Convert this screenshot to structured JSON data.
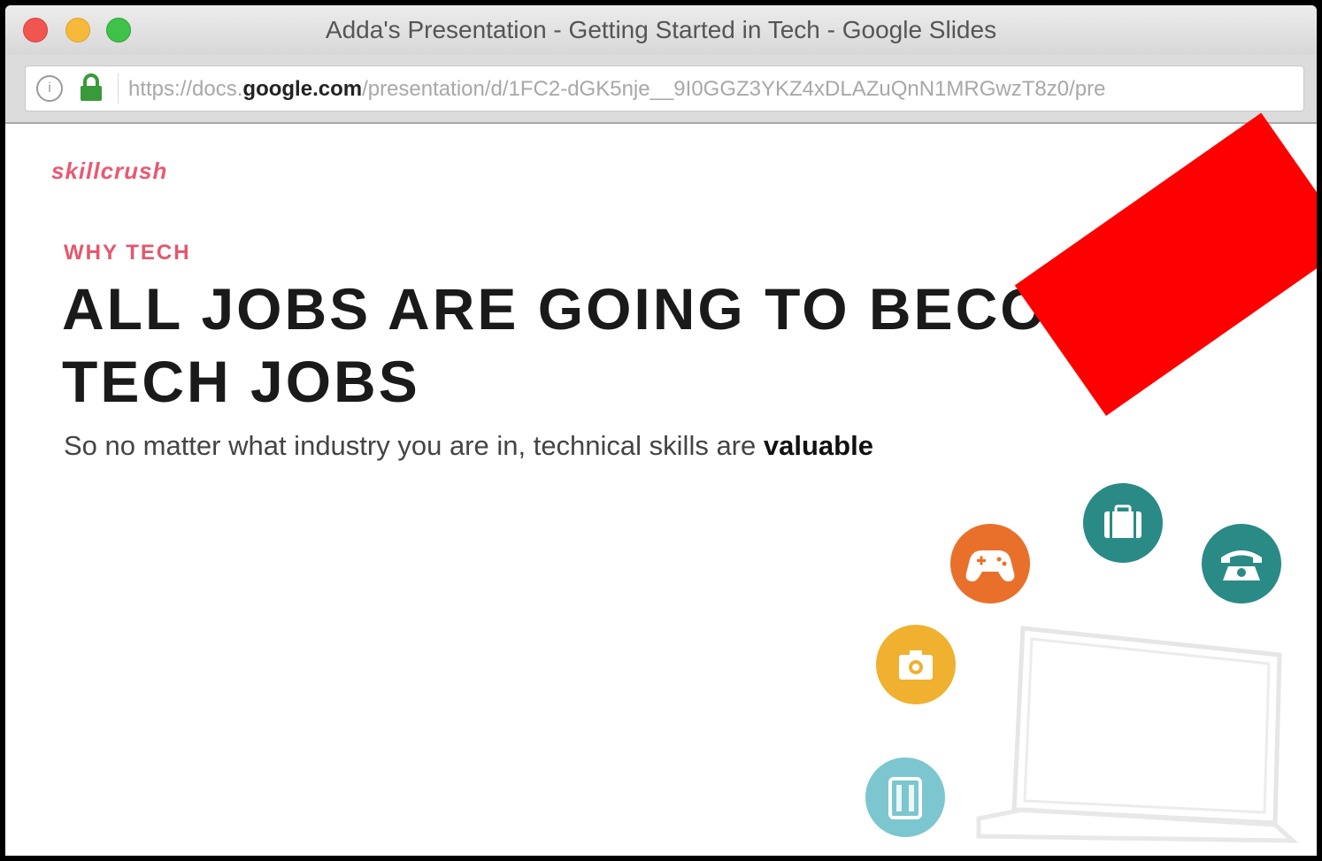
{
  "window": {
    "title": "Adda's Presentation - Getting Started in Tech - Google Slides"
  },
  "address_bar": {
    "url_prefix": "https://docs.",
    "url_host": "google.com",
    "url_path": "/presentation/d/1FC2-dGK5nje__9I0GGZ3YKZ4xDLAZuQnN1MRGwzT8z0/pre"
  },
  "slide": {
    "logo_text": "skillcrush",
    "eyebrow": "WHY TECH",
    "headline": "ALL JOBS ARE GOING TO BECOME TECH JOBS",
    "subhead_text": "So no matter what industry you are in, technical skills are ",
    "subhead_bold": "valuable"
  },
  "icons": {
    "game": "gamepad-icon",
    "briefcase": "briefcase-icon",
    "phone": "telephone-icon",
    "camera": "camera-icon",
    "tablet": "tablet-icon",
    "laptop": "laptop-icon"
  },
  "colors": {
    "accent": "#e4576c",
    "orange": "#e8702a",
    "teal": "#2a8a86",
    "yellow": "#efb12f",
    "light_teal": "#7cc7cf",
    "banner_red": "#ff0000"
  }
}
